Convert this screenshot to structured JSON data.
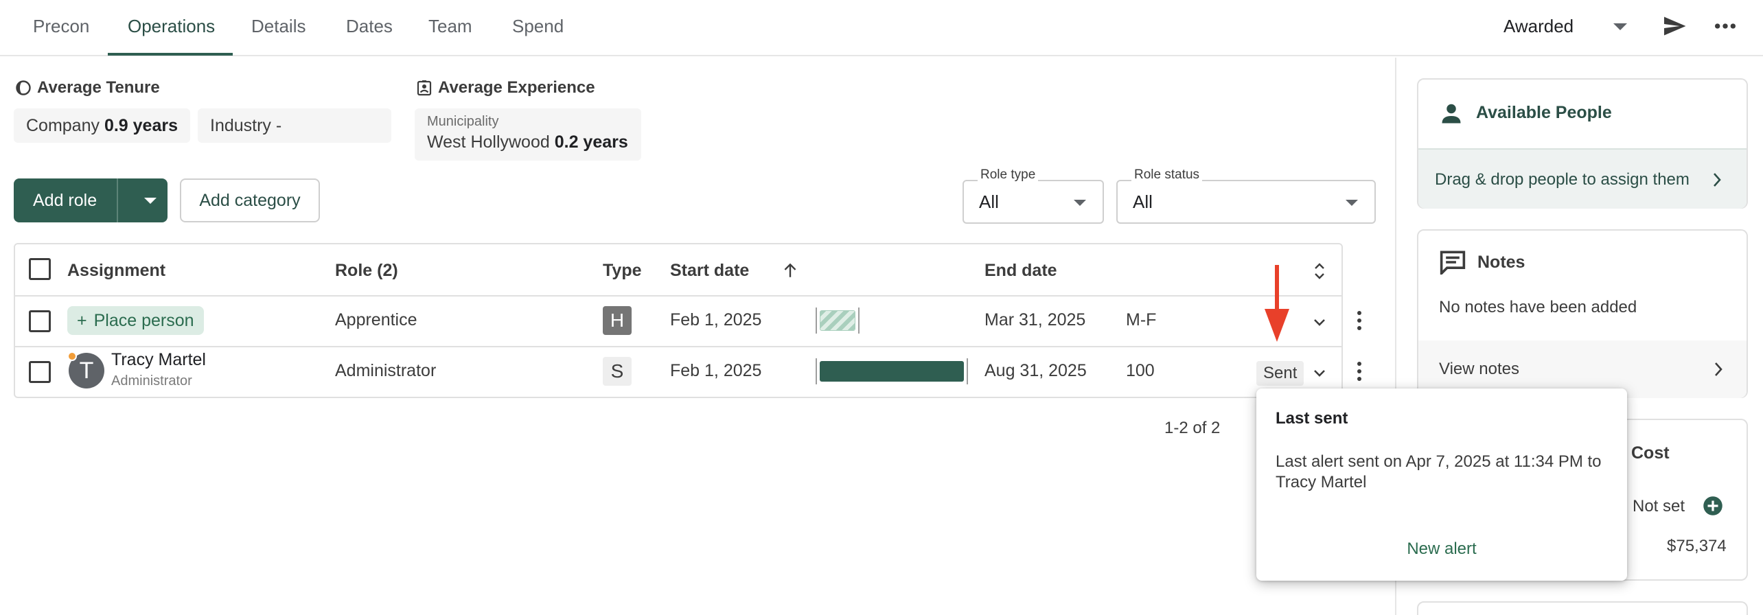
{
  "tabs": [
    {
      "label": "Precon"
    },
    {
      "label": "Operations"
    },
    {
      "label": "Details"
    },
    {
      "label": "Dates"
    },
    {
      "label": "Team"
    },
    {
      "label": "Spend"
    }
  ],
  "header": {
    "status_value": "Awarded"
  },
  "stats": {
    "tenure_heading": "Average Tenure",
    "company_label": "Company",
    "company_value": "0.9 years",
    "industry_label": "Industry",
    "industry_value": "-",
    "experience_heading": "Average Experience",
    "municipality_label": "Municipality",
    "municipality_name": "West Hollywood",
    "municipality_value": "0.2 years"
  },
  "toolbar": {
    "add_role_label": "Add role",
    "add_category_label": "Add category",
    "role_type_label": "Role type",
    "role_type_value": "All",
    "role_status_label": "Role status",
    "role_status_value": "All"
  },
  "table": {
    "headers": {
      "assignment": "Assignment",
      "role": "Role (2)",
      "type": "Type",
      "start_date": "Start date",
      "end_date": "End date"
    },
    "rows": [
      {
        "assignment": "Place person",
        "role": "Apprentice",
        "type": "H",
        "start": "Feb 1, 2025",
        "end": "Mar 31, 2025",
        "schedule": "M-F"
      },
      {
        "assignment": "Tracy Martel",
        "assignment_sub": "Administrator",
        "avatar_initial": "T",
        "role": "Administrator",
        "type": "S",
        "start": "Feb 1, 2025",
        "end": "Aug 31, 2025",
        "schedule": "100",
        "status": "Sent"
      }
    ],
    "pagination": "1-2 of 2"
  },
  "panel": {
    "available_title": "Available People",
    "available_hint": "Drag & drop people to assign them",
    "notes_title": "Notes",
    "notes_empty": "No notes have been added",
    "view_notes": "View notes",
    "cost_title": "Cost",
    "cost_not_set": "Not set",
    "cost_amount": "$75,374"
  },
  "popover": {
    "title": "Last sent",
    "body": "Last alert sent on Apr 7, 2025 at 11:34 PM to Tracy Martel",
    "action": "New alert"
  },
  "colors": {
    "primary": "#2f5e51",
    "accent_green_text": "#2b6c4f",
    "annotation_red": "#e8402a",
    "presence_dot": "#f29d38"
  },
  "icons": [
    "tenure-icon",
    "experience-icon",
    "send-icon",
    "more-icon",
    "sort-up-icon",
    "sort-toggle-icon",
    "person-icon",
    "notes-icon",
    "chevron-right-icon",
    "chevron-down-icon",
    "kebab-icon",
    "plus-icon",
    "plus-circle-icon"
  ]
}
